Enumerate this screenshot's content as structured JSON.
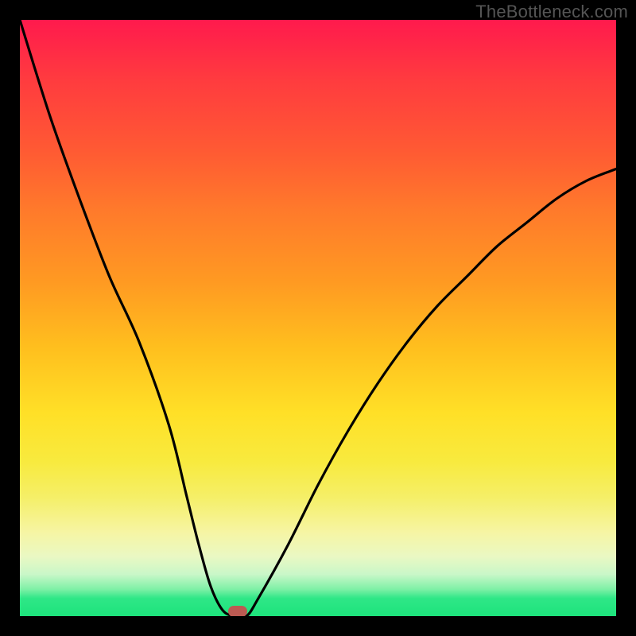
{
  "watermark": "TheBottleneck.com",
  "chart_data": {
    "type": "line",
    "title": "",
    "xlabel": "",
    "ylabel": "",
    "xlim": [
      0,
      100
    ],
    "ylim": [
      0,
      100
    ],
    "grid": false,
    "legend": false,
    "series": [
      {
        "name": "curve",
        "x": [
          0,
          5,
          10,
          15,
          20,
          25,
          28,
          30,
          32,
          34,
          36,
          38,
          40,
          45,
          50,
          55,
          60,
          65,
          70,
          75,
          80,
          85,
          90,
          95,
          100
        ],
        "y": [
          100,
          84,
          70,
          57,
          46,
          32,
          20,
          12,
          5,
          1,
          0,
          0,
          3,
          12,
          22,
          31,
          39,
          46,
          52,
          57,
          62,
          66,
          70,
          73,
          75
        ]
      }
    ],
    "marker": {
      "x": 36.5,
      "y": 0.8
    },
    "colors": {
      "curve": "#000000",
      "marker": "#bb5a52",
      "gradient_top": "#ff1a4d",
      "gradient_bottom": "#1de37c"
    }
  }
}
